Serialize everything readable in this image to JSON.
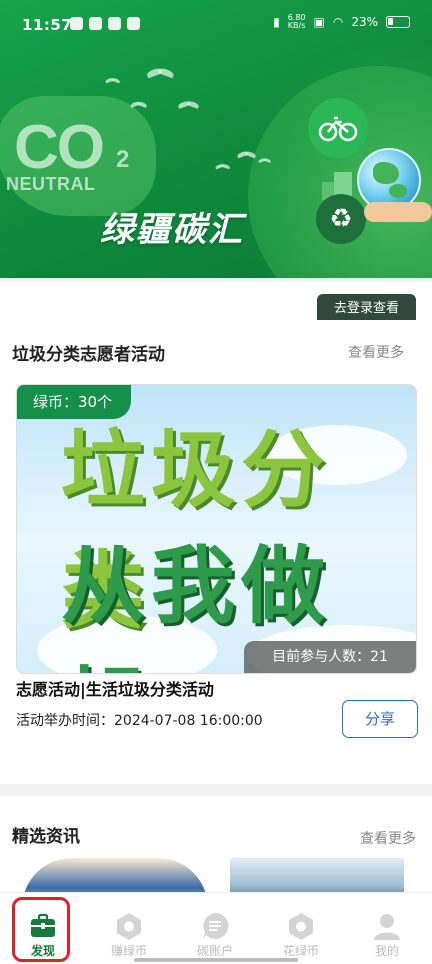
{
  "status_bar": {
    "time": "11:57",
    "net_speed_value": "6.80",
    "net_speed_unit": "KB/s",
    "battery": "23%"
  },
  "hero": {
    "co2_text": "CO",
    "co2_sub": "2",
    "neutral_text": "NEUTRAL",
    "title": "绿疆碳汇"
  },
  "login_button": "去登录查看",
  "volunteer_section": {
    "title": "垃圾分类志愿者活动",
    "see_more": "查看更多",
    "banner": {
      "line1": "垃圾分类",
      "line2": "从我做起"
    },
    "coin_badge": "绿币：30个",
    "participants": "目前参与人数：21",
    "activity_title": "志愿活动|生活垃圾分类活动",
    "activity_time": "活动举办时间：2024-07-08 16:00:00",
    "share_button": "分享"
  },
  "news_section": {
    "title": "精选资讯",
    "see_more": "查看更多"
  },
  "tabs": [
    {
      "label": "发现",
      "icon": "briefcase-icon",
      "active": true
    },
    {
      "label": "赚绿币",
      "icon": "hexagon-icon",
      "active": false
    },
    {
      "label": "碳账户",
      "icon": "document-bubble-icon",
      "active": false
    },
    {
      "label": "花绿币",
      "icon": "hexagon-icon",
      "active": false
    },
    {
      "label": "我的",
      "icon": "person-icon",
      "active": false
    }
  ],
  "colors": {
    "brand_green": "#15904a",
    "active_tab": "#177a3c",
    "highlight_red": "#e0202a",
    "share_blue": "#2f6fc0"
  }
}
